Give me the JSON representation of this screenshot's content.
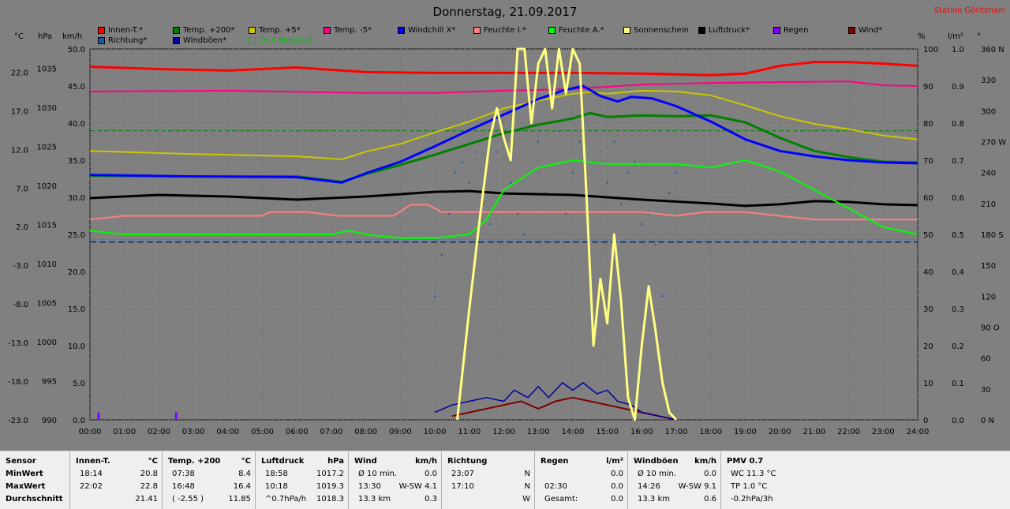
{
  "title": "Donnerstag, 21.09.2017",
  "station": "Station Göritzhain",
  "legend": [
    {
      "label": "Innen-T.*",
      "color": "#ff0000"
    },
    {
      "label": "Temp. +200*",
      "color": "#008000"
    },
    {
      "label": "Temp. +5*",
      "color": "#c8c800"
    },
    {
      "label": "Temp. -5*",
      "color": "#ff0080"
    },
    {
      "label": "Windchill X*",
      "color": "#0000ff"
    },
    {
      "label": "Feuchte I.*",
      "color": "#ff8080"
    },
    {
      "label": "Feuchte A.*",
      "color": "#00ff00"
    },
    {
      "label": "Sonnenschein",
      "color": "#ffff80"
    },
    {
      "label": "Luftdruck*",
      "color": "#000000"
    },
    {
      "label": "Regen",
      "color": "#8000ff"
    },
    {
      "label": "Wind*",
      "color": "#800000"
    },
    {
      "label": "Richtung*",
      "color": "#1e5aa0"
    },
    {
      "label": "Windböen*",
      "color": "#0000a0"
    },
    {
      "label": "14.4 Monat-Ø",
      "color": "#00c000"
    }
  ],
  "units": {
    "temp": "°C",
    "pressure": "hPa",
    "wind": "km/h",
    "percent": "%",
    "rain": "l/m²",
    "direction": "°"
  },
  "chart_data": {
    "type": "line",
    "x_ticks": [
      "00:00",
      "01:00",
      "02:00",
      "03:00",
      "04:00",
      "05:00",
      "06:00",
      "07:00",
      "08:00",
      "09:00",
      "10:00",
      "11:00",
      "12:00",
      "13:00",
      "14:00",
      "15:00",
      "16:00",
      "17:00",
      "18:00",
      "19:00",
      "20:00",
      "21:00",
      "22:00",
      "23:00",
      "24:00"
    ],
    "axes": {
      "temp": {
        "ticks": [
          "22.0",
          "17.0",
          "12.0",
          "7.0",
          "2.0",
          "-3.0",
          "-8.0",
          "-13.0",
          "-18.0",
          "-23.0"
        ],
        "range": [
          -23,
          25
        ]
      },
      "pressure": {
        "ticks": [
          "1035",
          "1030",
          "1025",
          "1020",
          "1015",
          "1010",
          "1005",
          "1000",
          "995",
          "990"
        ],
        "range": [
          990,
          1037.5
        ]
      },
      "wind": {
        "ticks": [
          "50.0",
          "45.0",
          "40.0",
          "35.0",
          "30.0",
          "25.0",
          "20.0",
          "15.0",
          "10.0",
          "5.0",
          "0.0"
        ],
        "range": [
          0,
          50
        ]
      },
      "percent": {
        "ticks": [
          "100",
          "90",
          "80",
          "70",
          "60",
          "50",
          "40",
          "30",
          "20",
          "10",
          "0"
        ],
        "range": [
          0,
          100
        ]
      },
      "rain": {
        "ticks": [
          "1.0",
          "0.9",
          "0.8",
          "0.7",
          "0.6",
          "0.5",
          "0.4",
          "0.3",
          "0.2",
          "0.1",
          "0.0"
        ],
        "range": [
          0,
          1
        ]
      },
      "direction": {
        "ticks": [
          "360 N",
          "330",
          "300",
          "270 W",
          "240",
          "210",
          "180 S",
          "150",
          "120",
          "90 O",
          "60",
          "30",
          "0 N"
        ],
        "range": [
          0,
          360
        ]
      }
    },
    "reference_lines": [
      {
        "name": "14.4 Monat-Ø",
        "axis": "temp",
        "value": 14.4,
        "color": "#008000"
      },
      {
        "axis": "temp",
        "value": 0,
        "color": "#000000"
      },
      {
        "axis": "temp",
        "value": 0.3,
        "color": "#2080ff"
      }
    ],
    "series": [
      {
        "name": "Innen-T.",
        "axis": "temp",
        "color": "#ff0000",
        "x": [
          0,
          2,
          4,
          6,
          8,
          10,
          12,
          14,
          16,
          18,
          19,
          20,
          21,
          22,
          23,
          24
        ],
        "y": [
          22.7,
          22.4,
          22.2,
          22.6,
          22.0,
          21.9,
          21.9,
          21.9,
          21.8,
          21.6,
          21.8,
          22.8,
          23.3,
          23.3,
          23.1,
          22.8
        ]
      },
      {
        "name": "Temp. +200",
        "axis": "temp",
        "color": "#008000",
        "x": [
          0,
          3,
          6,
          7.3,
          8,
          9,
          10,
          11,
          12,
          13,
          14,
          14.5,
          15,
          16,
          17,
          18,
          19,
          20,
          21,
          22,
          23,
          24
        ],
        "y": [
          8.6,
          8.5,
          8.5,
          7.8,
          8.8,
          10.0,
          11.3,
          12.7,
          14.1,
          15.2,
          16.0,
          16.7,
          16.2,
          16.4,
          16.3,
          16.4,
          15.5,
          13.5,
          11.8,
          11.0,
          10.4,
          10.3
        ]
      },
      {
        "name": "Temp. +5",
        "axis": "temp",
        "color": "#c8c800",
        "x": [
          0,
          3,
          6,
          7.3,
          8,
          9,
          10,
          11,
          12,
          13,
          14,
          14.5,
          15,
          16,
          17,
          18,
          19,
          20,
          21,
          22,
          23,
          24
        ],
        "y": [
          11.8,
          11.4,
          11.1,
          10.7,
          11.7,
          12.7,
          14.2,
          15.6,
          17.3,
          18.3,
          19.2,
          19.4,
          19.2,
          19.6,
          19.5,
          19.0,
          17.7,
          16.3,
          15.3,
          14.6,
          13.8,
          13.3
        ]
      },
      {
        "name": "Temp. -5",
        "axis": "temp",
        "color": "#ff0080",
        "x": [
          0,
          4,
          8,
          10,
          12,
          14,
          16,
          18,
          20,
          22,
          23,
          24
        ],
        "y": [
          19.5,
          19.6,
          19.3,
          19.3,
          19.6,
          19.8,
          20.4,
          20.6,
          20.7,
          20.8,
          20.3,
          20.2
        ]
      },
      {
        "name": "Windchill",
        "axis": "temp",
        "color": "#0000ff",
        "x": [
          0,
          3,
          6,
          7.3,
          8,
          9,
          10,
          11,
          12,
          13,
          13.7,
          14.3,
          14.8,
          15.3,
          15.7,
          16.3,
          17,
          18,
          19,
          20,
          21,
          22,
          23,
          24
        ],
        "y": [
          8.7,
          8.5,
          8.4,
          7.7,
          8.9,
          10.4,
          12.4,
          14.5,
          16.5,
          18.5,
          19.6,
          20.2,
          18.9,
          18.2,
          18.8,
          18.6,
          17.6,
          15.6,
          13.3,
          11.8,
          11.1,
          10.6,
          10.3,
          10.2
        ]
      },
      {
        "name": "Feuchte I.",
        "axis": "percent",
        "color": "#ff8080",
        "x": [
          0,
          1,
          2,
          5,
          5.2,
          6.3,
          7.2,
          8.8,
          9.3,
          9.8,
          10.2,
          11,
          12,
          16,
          17,
          17.8,
          19,
          20,
          21,
          22,
          23,
          24
        ],
        "y": [
          54,
          55,
          55,
          55,
          56,
          56,
          55,
          55,
          58,
          58,
          56,
          56,
          56,
          56,
          55,
          56,
          56,
          55,
          54,
          54,
          54,
          54
        ]
      },
      {
        "name": "Feuchte A.",
        "axis": "percent",
        "color": "#00ff00",
        "x": [
          0,
          1,
          2,
          7,
          7.5,
          8,
          9,
          10,
          11,
          11.5,
          12,
          13,
          14,
          15,
          16,
          17,
          18,
          18.5,
          19,
          20,
          21,
          22,
          23,
          24
        ],
        "y": [
          51,
          50,
          50,
          50,
          51,
          50,
          49,
          49,
          50,
          54,
          62,
          68,
          70,
          69,
          69,
          69,
          68,
          69,
          70,
          67,
          62,
          57,
          52,
          50
        ]
      },
      {
        "name": "Luftdruck",
        "axis": "pressure",
        "color": "#000000",
        "x": [
          0,
          2,
          4,
          6,
          8,
          10,
          11,
          12,
          14,
          16,
          18,
          19,
          20,
          21,
          22,
          23,
          24
        ],
        "y": [
          1018.4,
          1018.8,
          1018.6,
          1018.2,
          1018.6,
          1019.2,
          1019.3,
          1019.0,
          1018.8,
          1018.2,
          1017.7,
          1017.4,
          1017.6,
          1018.0,
          1017.9,
          1017.6,
          1017.5
        ]
      },
      {
        "name": "Wind",
        "axis": "wind",
        "color": "#800000",
        "x": [
          10.5,
          11,
          11.5,
          12,
          12.5,
          13,
          13.5,
          14,
          14.5,
          15,
          15.5,
          16,
          16.5,
          17
        ],
        "y": [
          0.5,
          1,
          1.5,
          2,
          2.5,
          1.5,
          2.5,
          3,
          2.5,
          2,
          1.5,
          1,
          0.5,
          0
        ]
      },
      {
        "name": "Windböen",
        "axis": "wind",
        "color": "#0000a0",
        "x": [
          10,
          10.5,
          11,
          11.5,
          12,
          12.3,
          12.7,
          13,
          13.3,
          13.7,
          14,
          14.3,
          14.7,
          15,
          15.3,
          15.7,
          16,
          16.5,
          17
        ],
        "y": [
          1,
          2,
          2.5,
          3,
          2.5,
          4,
          3,
          4.5,
          3,
          5,
          4,
          5,
          3.5,
          4,
          2.5,
          2,
          1,
          0.5,
          0
        ]
      },
      {
        "name": "Sonnenschein",
        "axis": "wind",
        "color": "#ffff80",
        "x": [
          10.65,
          11,
          11.3,
          11.6,
          11.8,
          12,
          12.2,
          12.4,
          12.6,
          12.8,
          13,
          13.2,
          13.4,
          13.6,
          13.8,
          14,
          14.2,
          14.4,
          14.6,
          14.8,
          15,
          15.2,
          15.4,
          15.6,
          15.8,
          16,
          16.2,
          16.4,
          16.6,
          16.8,
          17
        ],
        "y": [
          0,
          15,
          27,
          38,
          42,
          38,
          35,
          50,
          50,
          40,
          48,
          50,
          42,
          50,
          44,
          50,
          48,
          30,
          10,
          19,
          13,
          25,
          16,
          3,
          0,
          10,
          18,
          12,
          5,
          1,
          0
        ]
      },
      {
        "name": "Regen",
        "axis": "rain",
        "color": "#8000ff",
        "x": [
          0.25,
          2.5
        ],
        "y": [
          0.02,
          0.02
        ]
      }
    ],
    "direction_scatter": {
      "axis": "direction",
      "color": "#1e5aa0",
      "x": [
        10,
        10.2,
        10.4,
        10.6,
        10.8,
        11,
        11.2,
        11.4,
        11.6,
        11.8,
        12,
        12.2,
        12.4,
        12.6,
        12.8,
        13,
        13.2,
        13.4,
        13.6,
        13.8,
        14,
        14.2,
        14.4,
        14.6,
        14.8,
        15,
        15.2,
        15.4,
        15.6,
        15.8,
        16,
        16.2,
        16.4,
        16.6,
        16.8,
        17
      ],
      "y": [
        120,
        160,
        200,
        240,
        250,
        230,
        260,
        210,
        190,
        260,
        280,
        230,
        200,
        180,
        240,
        270,
        220,
        260,
        280,
        200,
        240,
        270,
        220,
        250,
        260,
        230,
        270,
        210,
        240,
        250,
        190,
        200,
        170,
        120,
        220,
        240
      ]
    },
    "grid": true,
    "x_range": [
      0,
      24
    ]
  },
  "stats": {
    "columns": [
      {
        "title": "Sensor",
        "unit": "",
        "rows": [
          {
            "time": "MinWert",
            "value": ""
          },
          {
            "time": "MaxWert",
            "value": ""
          },
          {
            "time": "Durchschnitt",
            "value": ""
          }
        ]
      },
      {
        "title": "Innen-T.",
        "unit": "°C",
        "rows": [
          {
            "time": "18:14",
            "value": "20.8"
          },
          {
            "time": "22:02",
            "value": "22.8"
          },
          {
            "time": "",
            "value": "21.41"
          }
        ]
      },
      {
        "title": "Temp. +200",
        "unit": "°C",
        "rows": [
          {
            "time": "07:38",
            "value": "8.4"
          },
          {
            "time": "16:48",
            "value": "16.4"
          },
          {
            "time": "( -2.55 )",
            "value": "11.85"
          }
        ]
      },
      {
        "title": "Luftdruck",
        "unit": "hPa",
        "rows": [
          {
            "time": "18:58",
            "value": "1017.2"
          },
          {
            "time": "10:18",
            "value": "1019.3"
          },
          {
            "time": "^0.7hPa/h",
            "value": "1018.3"
          }
        ]
      },
      {
        "title": "Wind",
        "unit": "km/h",
        "rows": [
          {
            "time": "Ø 10 min.",
            "value": "0.0"
          },
          {
            "time": "13:30",
            "mid": "W-SW 4.1",
            "value": ""
          },
          {
            "time": "13.3 km",
            "value": "0.3"
          }
        ]
      },
      {
        "title": "Richtung",
        "unit": "",
        "rows": [
          {
            "time": "23:07",
            "value": "N"
          },
          {
            "time": "17:10",
            "value": "N"
          },
          {
            "time": "",
            "value": "W"
          }
        ]
      },
      {
        "title": "Regen",
        "unit": "l/m²",
        "rows": [
          {
            "time": "",
            "value": "0.0"
          },
          {
            "time": "02:30",
            "value": "0.0"
          },
          {
            "time": "Gesamt:",
            "value": "0.0"
          }
        ]
      },
      {
        "title": "Windböen",
        "unit": "km/h",
        "rows": [
          {
            "time": "Ø 10 min.",
            "value": "0.0"
          },
          {
            "time": "14:26",
            "mid": "W-SW 9.1",
            "value": ""
          },
          {
            "time": "13.3 km",
            "value": "0.6"
          }
        ]
      },
      {
        "title": "PMV 0.7",
        "unit": "",
        "rows": [
          {
            "time": "WC 11.3 °C",
            "value": ""
          },
          {
            "time": "TP 1.0 °C",
            "value": ""
          },
          {
            "time": "-0.2hPa/3h",
            "value": ""
          }
        ]
      }
    ]
  }
}
